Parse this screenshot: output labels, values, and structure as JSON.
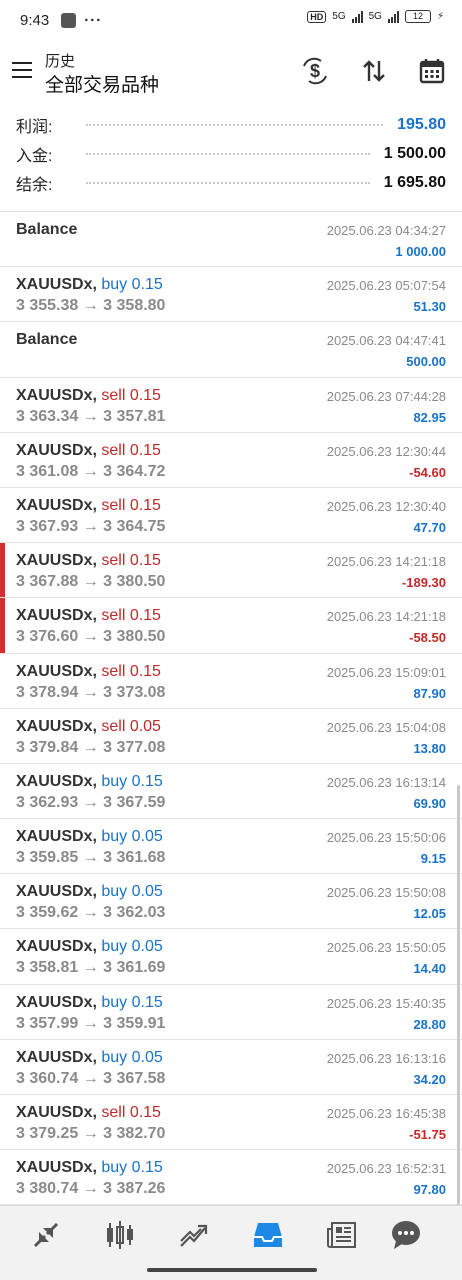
{
  "status": {
    "time": "9:43",
    "dots": "···",
    "hd": "HD",
    "net1": "5G",
    "net2": "5G",
    "battery": "12"
  },
  "header": {
    "subtitle": "历史",
    "title": "全部交易品种"
  },
  "summary": [
    {
      "label": "利润:",
      "value": "195.80",
      "highlight": true
    },
    {
      "label": "入金:",
      "value": "1 500.00",
      "highlight": false
    },
    {
      "label": "结余:",
      "value": "1 695.80",
      "highlight": false
    }
  ],
  "deals": [
    {
      "symbol": "Balance",
      "side": "",
      "side_class": "",
      "prices": "",
      "time": "2025.06.23 04:34:27",
      "profit": "1 000.00",
      "profit_class": "pos",
      "flag": false
    },
    {
      "symbol": "XAUUSDx,",
      "side": "buy 0.15",
      "side_class": "buy",
      "prices": "3 355.38 → 3 358.80",
      "time": "2025.06.23 05:07:54",
      "profit": "51.30",
      "profit_class": "pos",
      "flag": false
    },
    {
      "symbol": "Balance",
      "side": "",
      "side_class": "",
      "prices": "",
      "time": "2025.06.23 04:47:41",
      "profit": "500.00",
      "profit_class": "pos",
      "flag": false
    },
    {
      "symbol": "XAUUSDx,",
      "side": "sell 0.15",
      "side_class": "sell",
      "prices": "3 363.34 → 3 357.81",
      "time": "2025.06.23 07:44:28",
      "profit": "82.95",
      "profit_class": "pos",
      "flag": false
    },
    {
      "symbol": "XAUUSDx,",
      "side": "sell 0.15",
      "side_class": "sell",
      "prices": "3 361.08 → 3 364.72",
      "time": "2025.06.23 12:30:44",
      "profit": "-54.60",
      "profit_class": "neg",
      "flag": false
    },
    {
      "symbol": "XAUUSDx,",
      "side": "sell 0.15",
      "side_class": "sell",
      "prices": "3 367.93 → 3 364.75",
      "time": "2025.06.23 12:30:40",
      "profit": "47.70",
      "profit_class": "pos",
      "flag": false
    },
    {
      "symbol": "XAUUSDx,",
      "side": "sell 0.15",
      "side_class": "sell",
      "prices": "3 367.88 → 3 380.50",
      "time": "2025.06.23 14:21:18",
      "profit": "-189.30",
      "profit_class": "neg",
      "flag": true
    },
    {
      "symbol": "XAUUSDx,",
      "side": "sell 0.15",
      "side_class": "sell",
      "prices": "3 376.60 → 3 380.50",
      "time": "2025.06.23 14:21:18",
      "profit": "-58.50",
      "profit_class": "neg",
      "flag": true
    },
    {
      "symbol": "XAUUSDx,",
      "side": "sell 0.15",
      "side_class": "sell",
      "prices": "3 378.94 → 3 373.08",
      "time": "2025.06.23 15:09:01",
      "profit": "87.90",
      "profit_class": "pos",
      "flag": false
    },
    {
      "symbol": "XAUUSDx,",
      "side": "sell 0.05",
      "side_class": "sell",
      "prices": "3 379.84 → 3 377.08",
      "time": "2025.06.23 15:04:08",
      "profit": "13.80",
      "profit_class": "pos",
      "flag": false
    },
    {
      "symbol": "XAUUSDx,",
      "side": "buy 0.15",
      "side_class": "buy",
      "prices": "3 362.93 → 3 367.59",
      "time": "2025.06.23 16:13:14",
      "profit": "69.90",
      "profit_class": "pos",
      "flag": false
    },
    {
      "symbol": "XAUUSDx,",
      "side": "buy 0.05",
      "side_class": "buy",
      "prices": "3 359.85 → 3 361.68",
      "time": "2025.06.23 15:50:06",
      "profit": "9.15",
      "profit_class": "pos",
      "flag": false
    },
    {
      "symbol": "XAUUSDx,",
      "side": "buy 0.05",
      "side_class": "buy",
      "prices": "3 359.62 → 3 362.03",
      "time": "2025.06.23 15:50:08",
      "profit": "12.05",
      "profit_class": "pos",
      "flag": false
    },
    {
      "symbol": "XAUUSDx,",
      "side": "buy 0.05",
      "side_class": "buy",
      "prices": "3 358.81 → 3 361.69",
      "time": "2025.06.23 15:50:05",
      "profit": "14.40",
      "profit_class": "pos",
      "flag": false
    },
    {
      "symbol": "XAUUSDx,",
      "side": "buy 0.15",
      "side_class": "buy",
      "prices": "3 357.99 → 3 359.91",
      "time": "2025.06.23 15:40:35",
      "profit": "28.80",
      "profit_class": "pos",
      "flag": false
    },
    {
      "symbol": "XAUUSDx,",
      "side": "buy 0.05",
      "side_class": "buy",
      "prices": "3 360.74 → 3 367.58",
      "time": "2025.06.23 16:13:16",
      "profit": "34.20",
      "profit_class": "pos",
      "flag": false
    },
    {
      "symbol": "XAUUSDx,",
      "side": "sell 0.15",
      "side_class": "sell",
      "prices": "3 379.25 → 3 382.70",
      "time": "2025.06.23 16:45:38",
      "profit": "-51.75",
      "profit_class": "neg",
      "flag": false
    },
    {
      "symbol": "XAUUSDx,",
      "side": "buy 0.15",
      "side_class": "buy",
      "prices": "3 380.74 → 3 387.26",
      "time": "2025.06.23 16:52:31",
      "profit": "97.80",
      "profit_class": "pos",
      "flag": false
    }
  ],
  "icons": {
    "header": [
      "currency-exchange-icon",
      "sort-icon",
      "calendar-icon"
    ],
    "nav": [
      "quotes-icon",
      "chart-icon",
      "trade-icon",
      "history-icon",
      "news-icon",
      "chat-icon"
    ],
    "active_nav": "history-icon"
  },
  "colors": {
    "positive": "#1a73c9",
    "negative": "#c62828",
    "active_nav": "#1e88e5",
    "flag": "#d32f2f"
  }
}
